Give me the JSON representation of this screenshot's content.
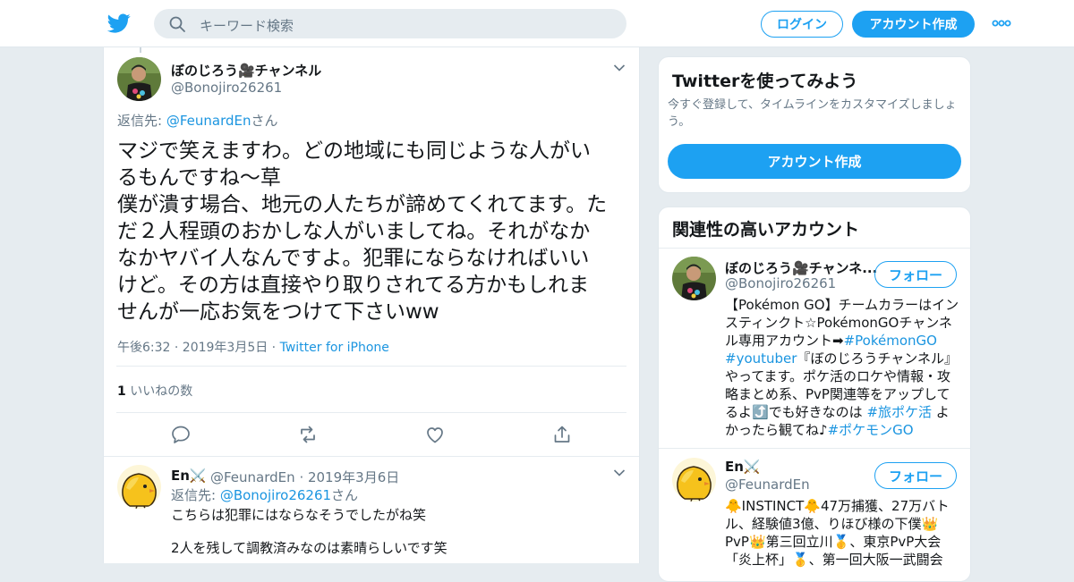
{
  "header": {
    "search_placeholder": "キーワード検索",
    "login_label": "ログイン",
    "signup_label": "アカウント作成",
    "brand_color": "#1da1f2"
  },
  "tweet": {
    "display_name": "ぼのじろう🎥チャンネル",
    "handle": "@Bonojiro26261",
    "reply_prefix": "返信先: ",
    "reply_handle": "@FeunardEn",
    "reply_suffix": "さん",
    "text_lines": [
      "マジで笑えますわ。どの地域にも同じような人がい",
      "るもんですね〜草",
      "僕が潰す場合、地元の人たちが諦めてくれてます。た",
      "だ２人程頭のおかしな人がいましてね。それがなか",
      "なかヤバイ人なんですよ。犯罪にならなければいい",
      "けど。その方は直接やり取りされてる方かもしれま",
      "せんが一応お気をつけて下さいww"
    ],
    "timestamp": "午後6:32 · 2019年3月5日",
    "source_sep": " · ",
    "source": "Twitter for iPhone",
    "like_count": "1",
    "like_label": "いいねの数"
  },
  "reply": {
    "display_name": "En⚔️",
    "handle": "@FeunardEn",
    "date": "· 2019年3月6日",
    "reply_prefix": "返信先: ",
    "reply_handle": "@Bonojiro26261",
    "reply_suffix": "さん",
    "line1": "こちらは犯罪にはならなそうでしたがね笑",
    "line2": "2人を残して調教済みなのは素晴らしいです笑"
  },
  "sidebar": {
    "signup_card": {
      "title": "Twitterを使ってみよう",
      "subtitle": "今すぐ登録して、タイムラインをカスタマイズしましょう。",
      "button": "アカウント作成"
    },
    "related": {
      "title": "関連性の高いアカウント",
      "accounts": [
        {
          "name": "ぼのじろう🎥チャンネ...",
          "handle": "@Bonojiro26261",
          "follow": "フォロー",
          "bio_lines": [
            "【Pokémon GO】チームカラーはイン",
            "スティンクト☆PokémonGOチャンネ",
            "ル専用アカウント➡#PokémonGO",
            "#youtuber『ぼのじろうチャンネル』",
            "やってます。ポケ活のロケや情報・攻",
            "略まとめ系、PvP関連等をアップして",
            "るよ⤴️でも好きなのは #旅ポケ活 よ",
            "かったら観てね♪#ポケモンGO"
          ]
        },
        {
          "name": "En⚔️",
          "handle": "@FeunardEn",
          "follow": "フォロー",
          "bio_lines": [
            "🐥INSTINCT🐥47万捕獲、27万バト",
            "ル、経験値3億、りほび様の下僕👑",
            "PvP👑第三回立川🥇、東京PvP大会",
            "「炎上杯」🥇、第一回大阪一武闘会"
          ]
        }
      ]
    }
  }
}
